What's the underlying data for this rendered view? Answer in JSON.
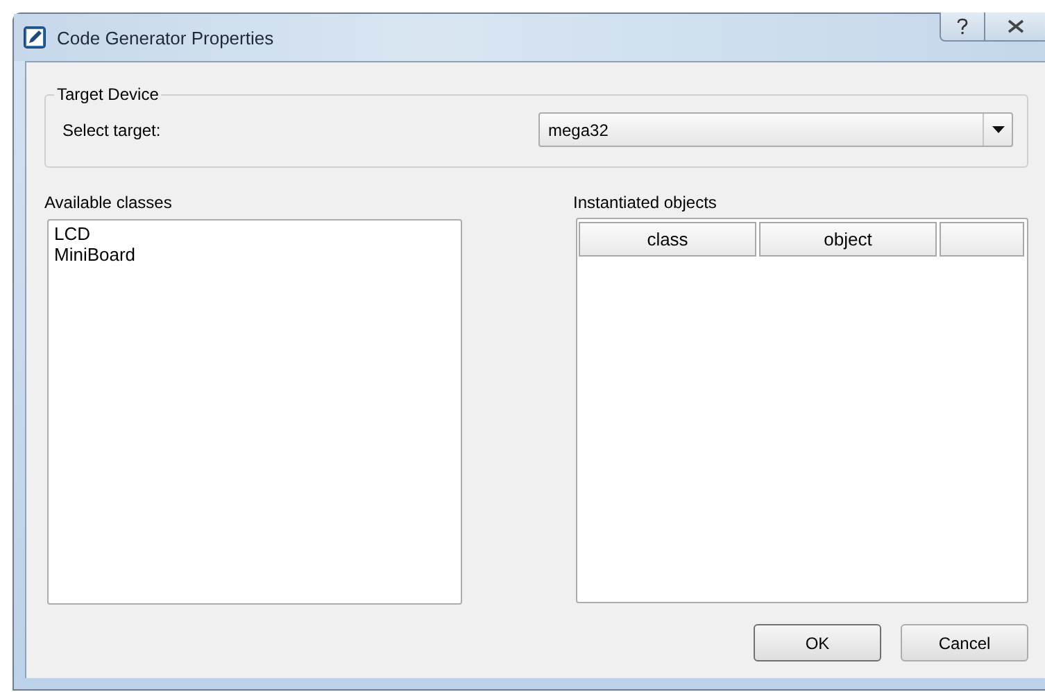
{
  "window": {
    "title": "Code Generator Properties"
  },
  "target_device": {
    "legend": "Target Device",
    "label": "Select target:",
    "value": "mega32"
  },
  "available_classes": {
    "label": "Available classes",
    "items": [
      {
        "text": "LCD"
      },
      {
        "text": "MiniBoard"
      }
    ]
  },
  "instantiated_objects": {
    "label": "Instantiated objects",
    "columns": [
      "class",
      "object"
    ]
  },
  "buttons": [
    {
      "label": "OK",
      "default": true
    },
    {
      "label": "Cancel",
      "default": false
    }
  ]
}
